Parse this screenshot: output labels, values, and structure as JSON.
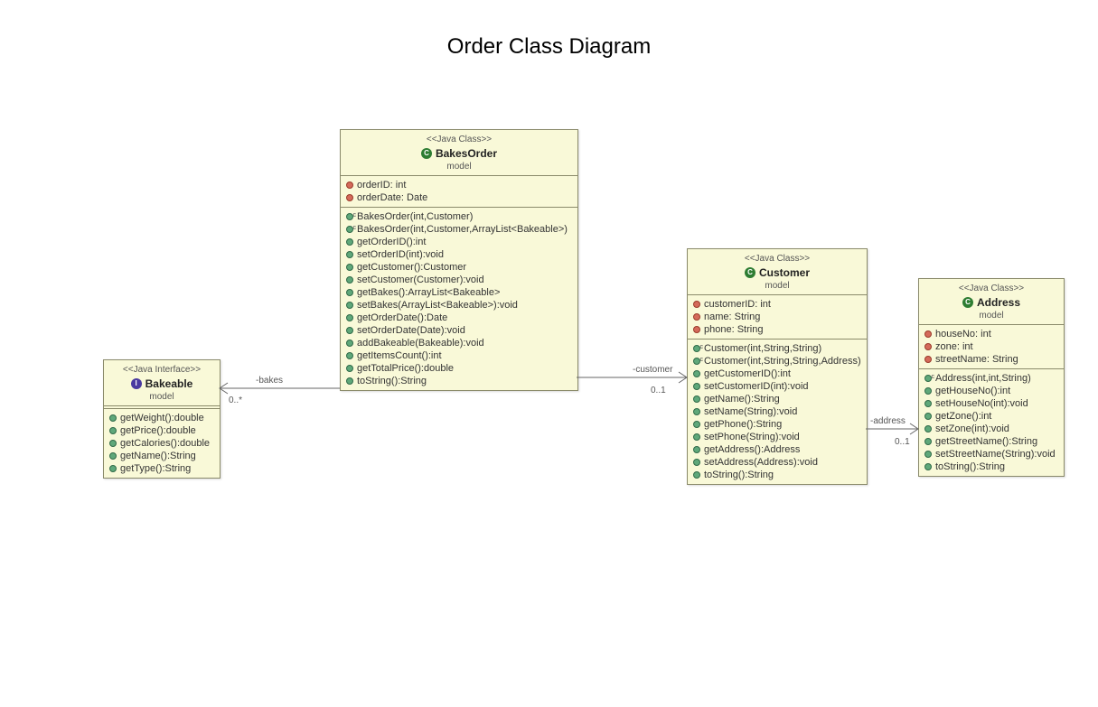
{
  "title": "Order Class Diagram",
  "classes": {
    "bakeable": {
      "stereotype": "<<Java Interface>>",
      "name": "Bakeable",
      "package": "model",
      "icon": "interface",
      "attributes": [],
      "operations": [
        {
          "text": "getWeight():double"
        },
        {
          "text": "getPrice():double"
        },
        {
          "text": "getCalories():double"
        },
        {
          "text": "getName():String"
        },
        {
          "text": "getType():String"
        }
      ]
    },
    "bakesorder": {
      "stereotype": "<<Java Class>>",
      "name": "BakesOrder",
      "package": "model",
      "icon": "class",
      "attributes": [
        {
          "text": "orderID: int"
        },
        {
          "text": "orderDate: Date"
        }
      ],
      "operations": [
        {
          "text": "BakesOrder(int,Customer)",
          "ctor": true
        },
        {
          "text": "BakesOrder(int,Customer,ArrayList<Bakeable>)",
          "ctor": true
        },
        {
          "text": "getOrderID():int"
        },
        {
          "text": "setOrderID(int):void"
        },
        {
          "text": "getCustomer():Customer"
        },
        {
          "text": "setCustomer(Customer):void"
        },
        {
          "text": "getBakes():ArrayList<Bakeable>"
        },
        {
          "text": "setBakes(ArrayList<Bakeable>):void"
        },
        {
          "text": "getOrderDate():Date"
        },
        {
          "text": "setOrderDate(Date):void"
        },
        {
          "text": "addBakeable(Bakeable):void"
        },
        {
          "text": "getItemsCount():int"
        },
        {
          "text": "getTotalPrice():double"
        },
        {
          "text": "toString():String"
        }
      ]
    },
    "customer": {
      "stereotype": "<<Java Class>>",
      "name": "Customer",
      "package": "model",
      "icon": "class",
      "attributes": [
        {
          "text": "customerID: int"
        },
        {
          "text": "name: String"
        },
        {
          "text": "phone: String"
        }
      ],
      "operations": [
        {
          "text": "Customer(int,String,String)",
          "ctor": true
        },
        {
          "text": "Customer(int,String,String,Address)",
          "ctor": true
        },
        {
          "text": "getCustomerID():int"
        },
        {
          "text": "setCustomerID(int):void"
        },
        {
          "text": "getName():String"
        },
        {
          "text": "setName(String):void"
        },
        {
          "text": "getPhone():String"
        },
        {
          "text": "setPhone(String):void"
        },
        {
          "text": "getAddress():Address"
        },
        {
          "text": "setAddress(Address):void"
        },
        {
          "text": "toString():String"
        }
      ]
    },
    "address": {
      "stereotype": "<<Java Class>>",
      "name": "Address",
      "package": "model",
      "icon": "class",
      "attributes": [
        {
          "text": "houseNo: int"
        },
        {
          "text": "zone: int"
        },
        {
          "text": "streetName: String"
        }
      ],
      "operations": [
        {
          "text": "Address(int,int,String)",
          "ctor": true
        },
        {
          "text": "getHouseNo():int"
        },
        {
          "text": "setHouseNo(int):void"
        },
        {
          "text": "getZone():int"
        },
        {
          "text": "setZone(int):void"
        },
        {
          "text": "getStreetName():String"
        },
        {
          "text": "setStreetName(String):void"
        },
        {
          "text": "toString():String"
        }
      ]
    }
  },
  "associations": {
    "bakes": {
      "label": "-bakes",
      "multiplicity": "0..*"
    },
    "customer": {
      "label": "-customer",
      "multiplicity": "0..1"
    },
    "address": {
      "label": "-address",
      "multiplicity": "0..1"
    }
  }
}
